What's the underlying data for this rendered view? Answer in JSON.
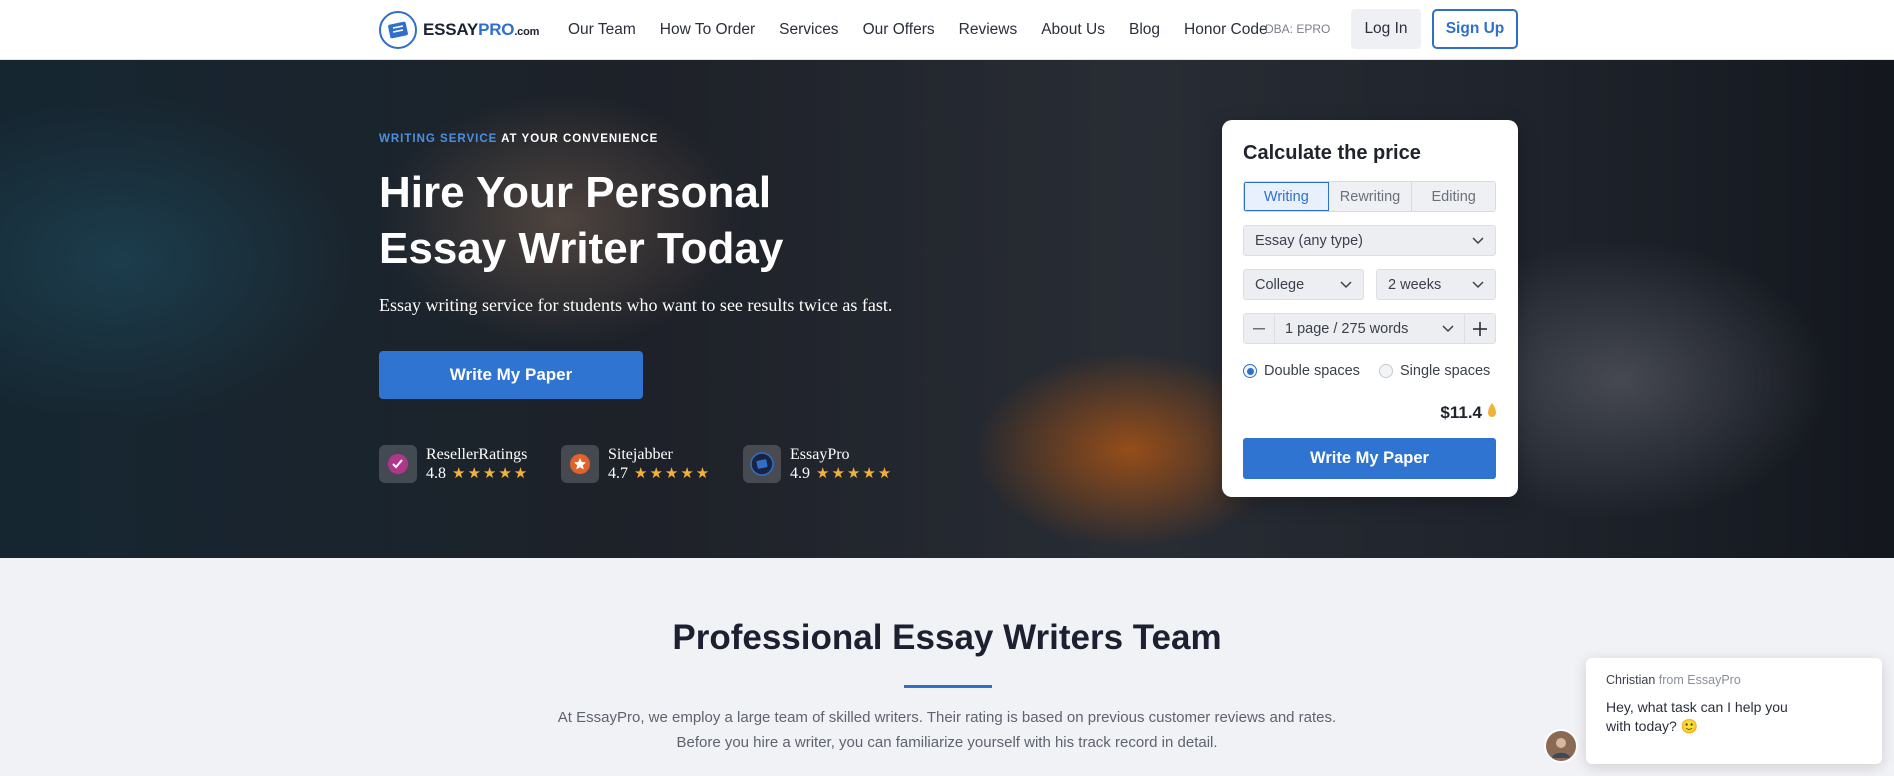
{
  "header": {
    "logo": {
      "brand_a": "ESSAY",
      "brand_b": "PRO",
      "brand_c": ".com"
    },
    "nav": [
      "Our Team",
      "How To Order",
      "Services",
      "Our Offers",
      "Reviews",
      "About Us",
      "Blog",
      "Honor Code"
    ],
    "dba": "DBA: EPRO",
    "login_label": "Log In",
    "signup_label": "Sign Up"
  },
  "hero": {
    "eyebrow_accent": "WRITING SERVICE",
    "eyebrow_rest": " AT YOUR CONVENIENCE",
    "headline": "Hire Your Personal Essay Writer Today",
    "subline": "Essay writing service for students who want to see results twice as fast.",
    "cta_label": "Write My Paper",
    "ratings": [
      {
        "name": "ResellerRatings",
        "score": "4.8",
        "icon": "check-badge-icon",
        "stars": 5
      },
      {
        "name": "Sitejabber",
        "score": "4.7",
        "icon": "star-badge-icon",
        "stars": 5
      },
      {
        "name": "EssayPro",
        "score": "4.9",
        "icon": "essaypro-badge-icon",
        "stars": 5
      }
    ]
  },
  "calculator": {
    "title": "Calculate the price",
    "tabs": [
      "Writing",
      "Rewriting",
      "Editing"
    ],
    "active_tab": "Writing",
    "paper_type": "Essay (any type)",
    "level": "College",
    "deadline": "2 weeks",
    "pages": "1 page / 275 words",
    "spacing_options": [
      "Double spaces",
      "Single spaces"
    ],
    "spacing_selected": "Double spaces",
    "price": "$11.4",
    "cta_label": "Write My Paper"
  },
  "section": {
    "title": "Professional Essay Writers Team",
    "text_line1": "At EssayPro, we employ a large team of skilled writers. Their rating is based on previous customer reviews and rates.",
    "text_line2": "Before you hire a writer, you can familiarize yourself with his track record in detail."
  },
  "chat": {
    "agent": "Christian",
    "from": " from EssayPro",
    "message": "Hey, what task can I help you with today? 🙂"
  },
  "colors": {
    "accent": "#2f6fcc",
    "cta": "#2f74d0",
    "star": "#f2b23a"
  }
}
